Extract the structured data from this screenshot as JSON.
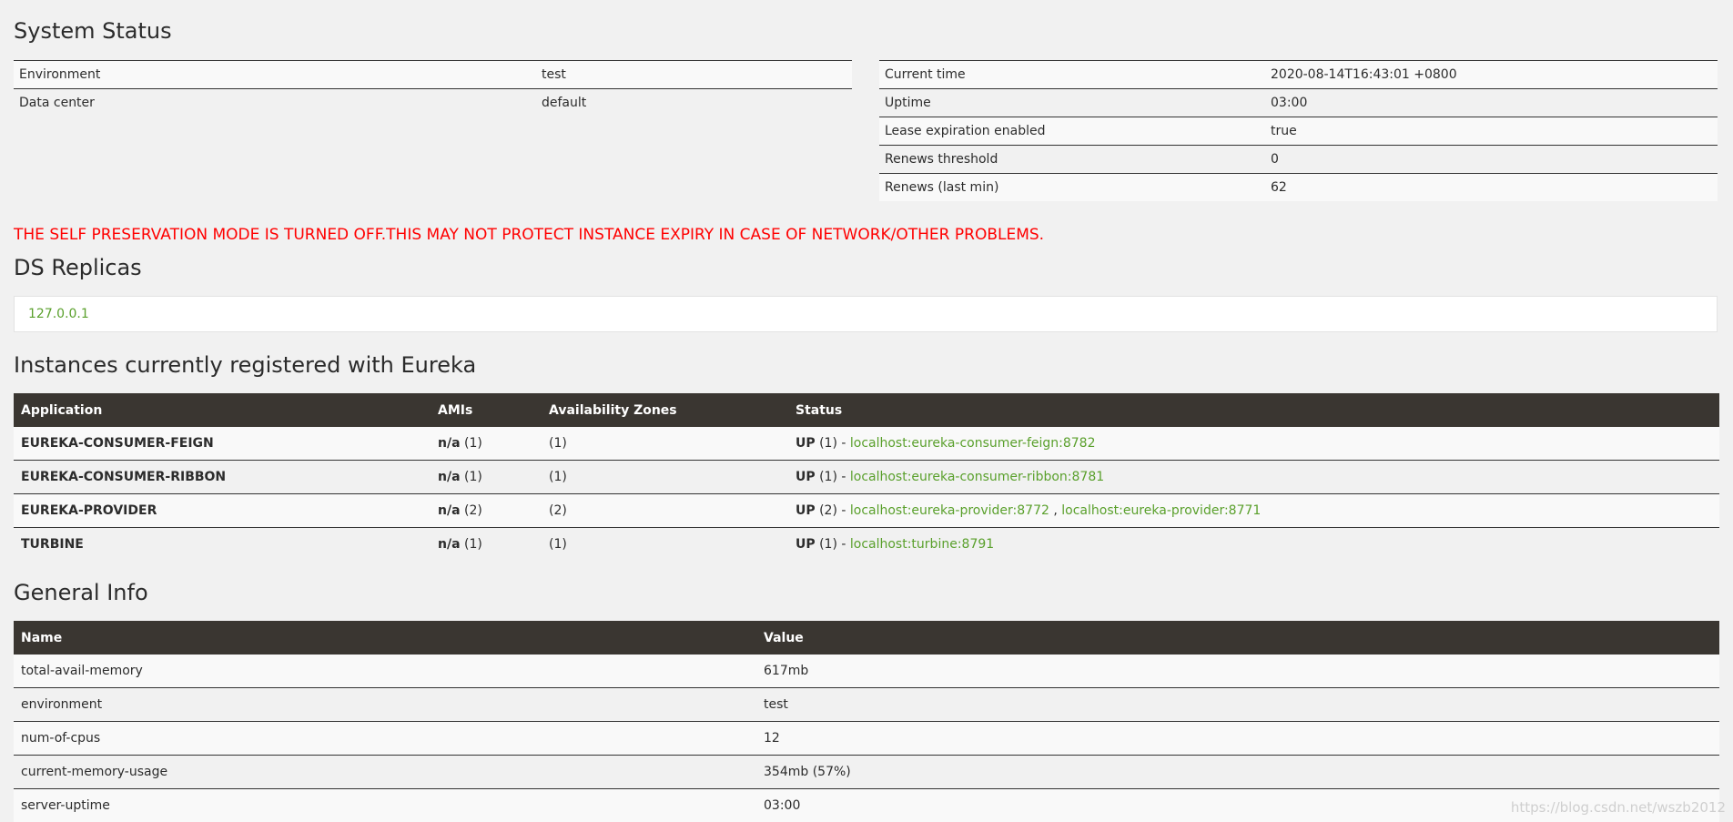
{
  "system_status": {
    "title": "System Status",
    "left": [
      {
        "label": "Environment",
        "value": "test"
      },
      {
        "label": "Data center",
        "value": "default"
      }
    ],
    "right": [
      {
        "label": "Current time",
        "value": "2020-08-14T16:43:01 +0800"
      },
      {
        "label": "Uptime",
        "value": "03:00"
      },
      {
        "label": "Lease expiration enabled",
        "value": "true"
      },
      {
        "label": "Renews threshold",
        "value": "0"
      },
      {
        "label": "Renews (last min)",
        "value": "62"
      }
    ]
  },
  "alert": "THE SELF PRESERVATION MODE IS TURNED OFF.THIS MAY NOT PROTECT INSTANCE EXPIRY IN CASE OF NETWORK/OTHER PROBLEMS.",
  "replicas": {
    "title": "DS Replicas",
    "link": "127.0.0.1"
  },
  "instances": {
    "title": "Instances currently registered with Eureka",
    "headers": {
      "application": "Application",
      "amis": "AMIs",
      "zones": "Availability Zones",
      "status": "Status"
    },
    "rows": [
      {
        "application": "EUREKA-CONSUMER-FEIGN",
        "ami": "n/a",
        "ami_count": " (1)",
        "zones": "(1)",
        "status": "UP",
        "status_count": " (1) - ",
        "links": [
          "localhost:eureka-consumer-feign:8782"
        ]
      },
      {
        "application": "EUREKA-CONSUMER-RIBBON",
        "ami": "n/a",
        "ami_count": " (1)",
        "zones": "(1)",
        "status": "UP",
        "status_count": " (1) - ",
        "links": [
          "localhost:eureka-consumer-ribbon:8781"
        ]
      },
      {
        "application": "EUREKA-PROVIDER",
        "ami": "n/a",
        "ami_count": " (2)",
        "zones": "(2)",
        "status": "UP",
        "status_count": " (2) - ",
        "links": [
          "localhost:eureka-provider:8772",
          "localhost:eureka-provider:8771"
        ]
      },
      {
        "application": "TURBINE",
        "ami": "n/a",
        "ami_count": " (1)",
        "zones": "(1)",
        "status": "UP",
        "status_count": " (1) - ",
        "links": [
          "localhost:turbine:8791"
        ]
      }
    ],
    "link_separator": " , "
  },
  "general_info": {
    "title": "General Info",
    "headers": {
      "name": "Name",
      "value": "Value"
    },
    "rows": [
      {
        "name": "total-avail-memory",
        "value": "617mb"
      },
      {
        "name": "environment",
        "value": "test"
      },
      {
        "name": "num-of-cpus",
        "value": "12"
      },
      {
        "name": "current-memory-usage",
        "value": "354mb (57%)"
      },
      {
        "name": "server-uptime",
        "value": "03:00"
      }
    ]
  },
  "watermark": "https://blog.csdn.net/wszb2012",
  "colors": {
    "link": "#5aa02c",
    "alert": "#ff0000",
    "header_bg": "#3a3631"
  }
}
